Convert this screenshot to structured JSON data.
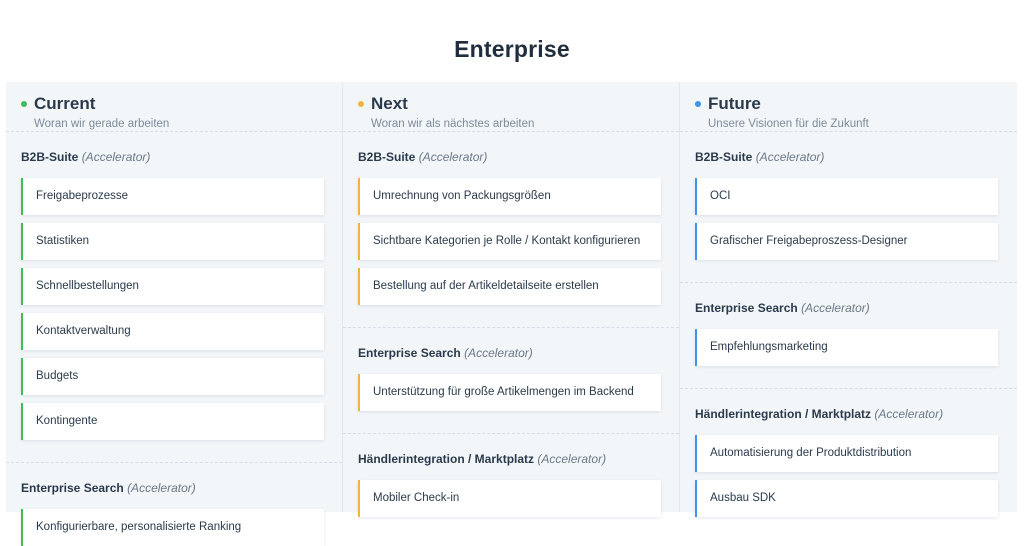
{
  "page": {
    "title": "Enterprise"
  },
  "columns": [
    {
      "key": "current",
      "title": "Current",
      "subtitle": "Woran wir gerade arbeiten",
      "dot_color": "#3fbd58",
      "groups": [
        {
          "name": "B2B-Suite",
          "tag": "(Accelerator)",
          "items": [
            "Freigabeprozesse",
            "Statistiken",
            "Schnellbestellungen",
            "Kontaktverwaltung",
            "Budgets",
            "Kontingente"
          ]
        },
        {
          "name": "Enterprise Search",
          "tag": "(Accelerator)",
          "items": [
            "Konfigurierbare, personalisierte Ranking"
          ]
        }
      ]
    },
    {
      "key": "next",
      "title": "Next",
      "subtitle": "Woran wir als nächstes arbeiten",
      "dot_color": "#f2b43a",
      "groups": [
        {
          "name": "B2B-Suite",
          "tag": "(Accelerator)",
          "items": [
            "Umrechnung von Packungsgrößen",
            "Sichtbare Kategorien je Rolle / Kontakt konfigurieren",
            "Bestellung auf der Artikeldetailseite erstellen"
          ]
        },
        {
          "name": "Enterprise Search",
          "tag": "(Accelerator)",
          "items": [
            "Unterstützung für große Artikelmengen im Backend"
          ]
        },
        {
          "name": "Händlerintegration / Marktplatz",
          "tag": "(Accelerator)",
          "items": [
            "Mobiler Check-in"
          ]
        }
      ]
    },
    {
      "key": "future",
      "title": "Future",
      "subtitle": "Unsere Visionen für die Zukunft",
      "dot_color": "#3d96e8",
      "groups": [
        {
          "name": "B2B-Suite",
          "tag": "(Accelerator)",
          "items": [
            "OCI",
            "Grafischer Freigabeproszess-Designer"
          ]
        },
        {
          "name": "Enterprise Search",
          "tag": "(Accelerator)",
          "items": [
            "Empfehlungsmarketing"
          ]
        },
        {
          "name": "Händlerintegration / Marktplatz",
          "tag": "(Accelerator)",
          "items": [
            "Automatisierung der Produktdistribution",
            "Ausbau SDK"
          ]
        }
      ]
    }
  ]
}
